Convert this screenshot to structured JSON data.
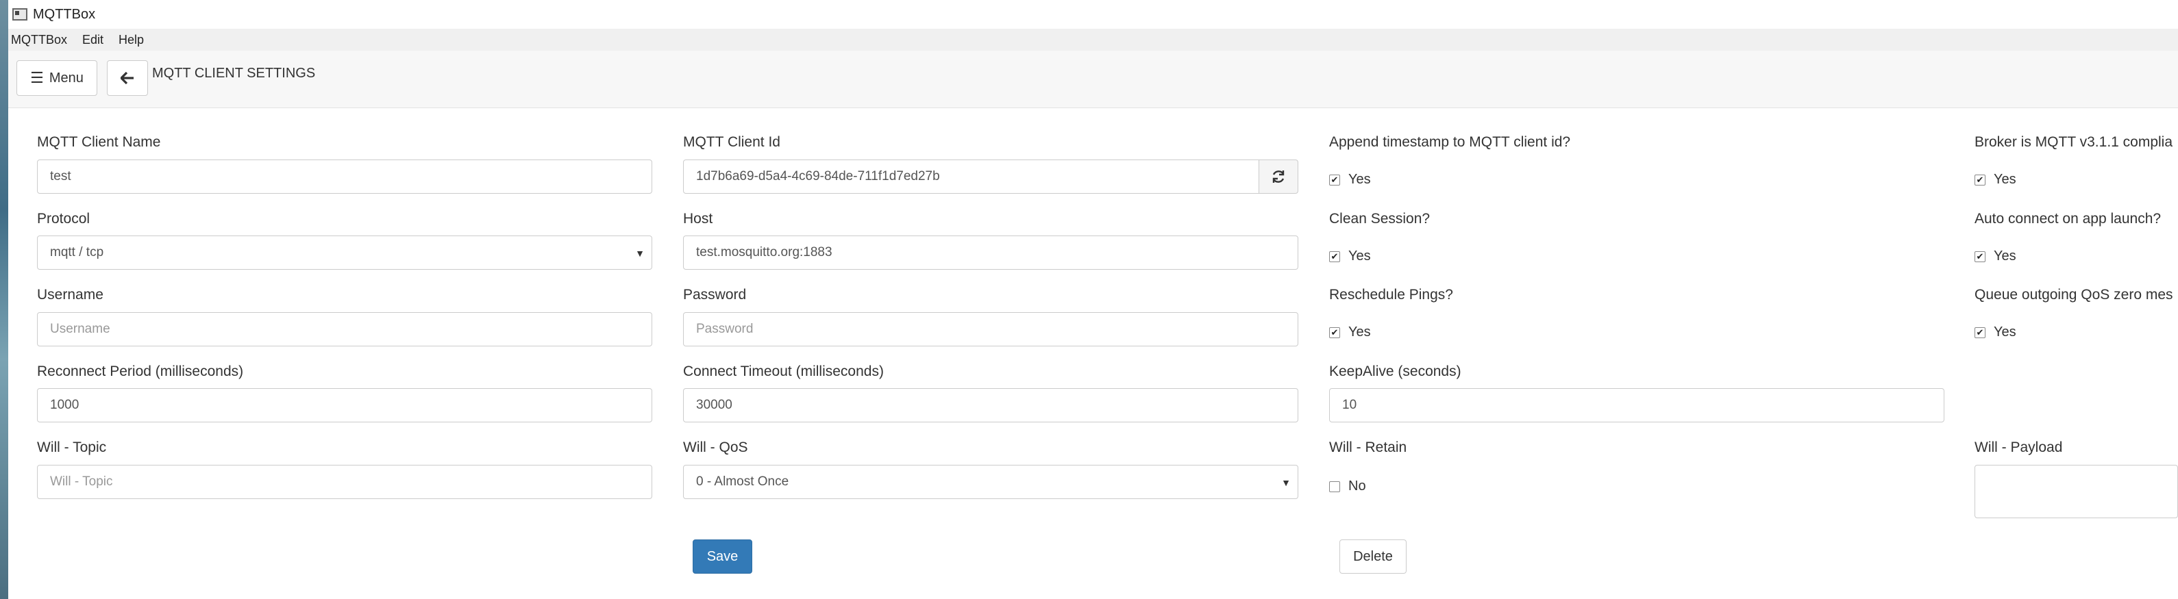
{
  "window": {
    "title": "MQTTBox"
  },
  "menubar": {
    "items": [
      "MQTTBox",
      "Edit",
      "Help"
    ]
  },
  "toolbar": {
    "menu_label": "Menu",
    "page_title": "MQTT CLIENT SETTINGS"
  },
  "form": {
    "client_name": {
      "label": "MQTT Client Name",
      "value": "test"
    },
    "client_id": {
      "label": "MQTT Client Id",
      "value": "1d7b6a69-d5a4-4c69-84de-711f1d7ed27b"
    },
    "append_timestamp": {
      "label": "Append timestamp to MQTT client id?",
      "option": "Yes",
      "checked": true
    },
    "broker_v311": {
      "label": "Broker is MQTT v3.1.1 complia",
      "option": "Yes",
      "checked": true
    },
    "protocol": {
      "label": "Protocol",
      "value": "mqtt / tcp"
    },
    "host": {
      "label": "Host",
      "value": "test.mosquitto.org:1883"
    },
    "clean_session": {
      "label": "Clean Session?",
      "option": "Yes",
      "checked": true
    },
    "auto_connect": {
      "label": "Auto connect on app launch?",
      "option": "Yes",
      "checked": true
    },
    "username": {
      "label": "Username",
      "placeholder": "Username"
    },
    "password": {
      "label": "Password",
      "placeholder": "Password"
    },
    "reschedule_pings": {
      "label": "Reschedule Pings?",
      "option": "Yes",
      "checked": true
    },
    "queue_outgoing": {
      "label": "Queue outgoing QoS zero mes",
      "option": "Yes",
      "checked": true
    },
    "reconnect_period": {
      "label": "Reconnect Period (milliseconds)",
      "value": "1000"
    },
    "connect_timeout": {
      "label": "Connect Timeout (milliseconds)",
      "value": "30000"
    },
    "keepalive": {
      "label": "KeepAlive (seconds)",
      "value": "10"
    },
    "will_topic": {
      "label": "Will - Topic",
      "placeholder": "Will - Topic"
    },
    "will_qos": {
      "label": "Will - QoS",
      "value": "0 - Almost Once"
    },
    "will_retain": {
      "label": "Will - Retain",
      "option": "No",
      "checked": false
    },
    "will_payload": {
      "label": "Will - Payload"
    }
  },
  "actions": {
    "save_label": "Save",
    "delete_label": "Delete"
  },
  "colors": {
    "primary": "#337ab7",
    "border": "#cccccc",
    "toolbar_bg": "#f7f7f7"
  },
  "icons": {
    "menu": "hamburger-icon",
    "back": "arrow-left-icon",
    "refresh": "refresh-icon",
    "select": "caret-down-icon"
  }
}
